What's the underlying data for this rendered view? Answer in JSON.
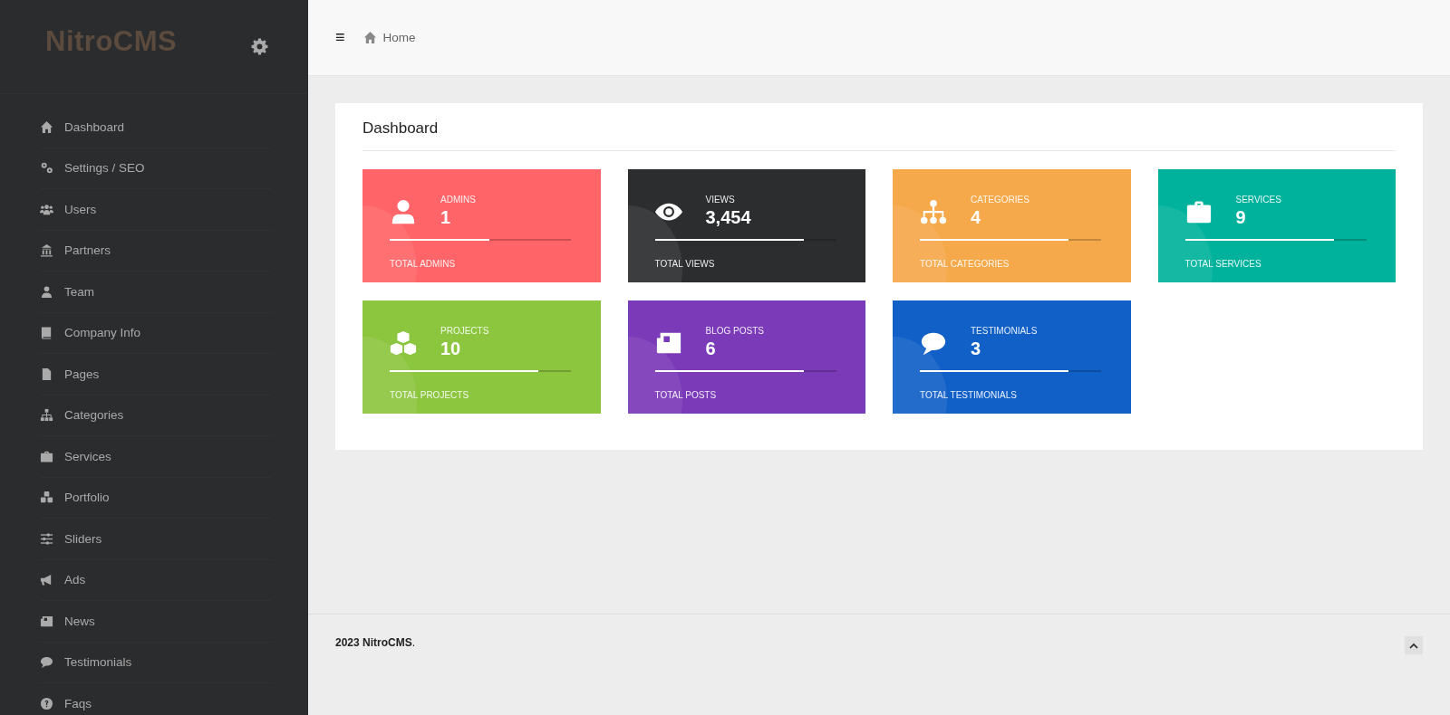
{
  "sidebar": {
    "logo": "NitroCMS",
    "items": [
      {
        "label": "Dashboard"
      },
      {
        "label": "Settings / SEO"
      },
      {
        "label": "Users"
      },
      {
        "label": "Partners"
      },
      {
        "label": "Team"
      },
      {
        "label": "Company Info"
      },
      {
        "label": "Pages"
      },
      {
        "label": "Categories"
      },
      {
        "label": "Services"
      },
      {
        "label": "Portfolio"
      },
      {
        "label": "Sliders"
      },
      {
        "label": "Ads"
      },
      {
        "label": "News"
      },
      {
        "label": "Testimonials"
      },
      {
        "label": "Faqs"
      }
    ]
  },
  "topbar": {
    "menu": "≡",
    "breadcrumb": "Home"
  },
  "panel": {
    "title": "Dashboard",
    "cards": [
      {
        "label": "ADMINS",
        "value": "1",
        "level": 0.55,
        "footer": "TOTAL ADMINS",
        "color": "#ff6468"
      },
      {
        "label": "VIEWS",
        "value": "3,454",
        "level": 0.82,
        "footer": "TOTAL VIEWS",
        "color": "#2c2d2f"
      },
      {
        "label": "CATEGORIES",
        "value": "4",
        "level": 0.82,
        "footer": "TOTAL CATEGORIES",
        "color": "#f6a94a"
      },
      {
        "label": "SERVICES",
        "value": "9",
        "level": 0.82,
        "footer": "TOTAL SERVICES",
        "color": "#00b29c"
      },
      {
        "label": "PROJECTS",
        "value": "10",
        "level": 0.82,
        "footer": "TOTAL PROJECTS",
        "color": "#8cc63f"
      },
      {
        "label": "BLOG POSTS",
        "value": "6",
        "level": 0.82,
        "footer": "TOTAL POSTS",
        "color": "#7b3ab8"
      },
      {
        "label": "TESTIMONIALS",
        "value": "3",
        "level": 0.82,
        "footer": "TOTAL TESTIMONIALS",
        "color": "#1160c8"
      }
    ]
  },
  "footer": {
    "text": "**2023 NitroCMS**."
  }
}
